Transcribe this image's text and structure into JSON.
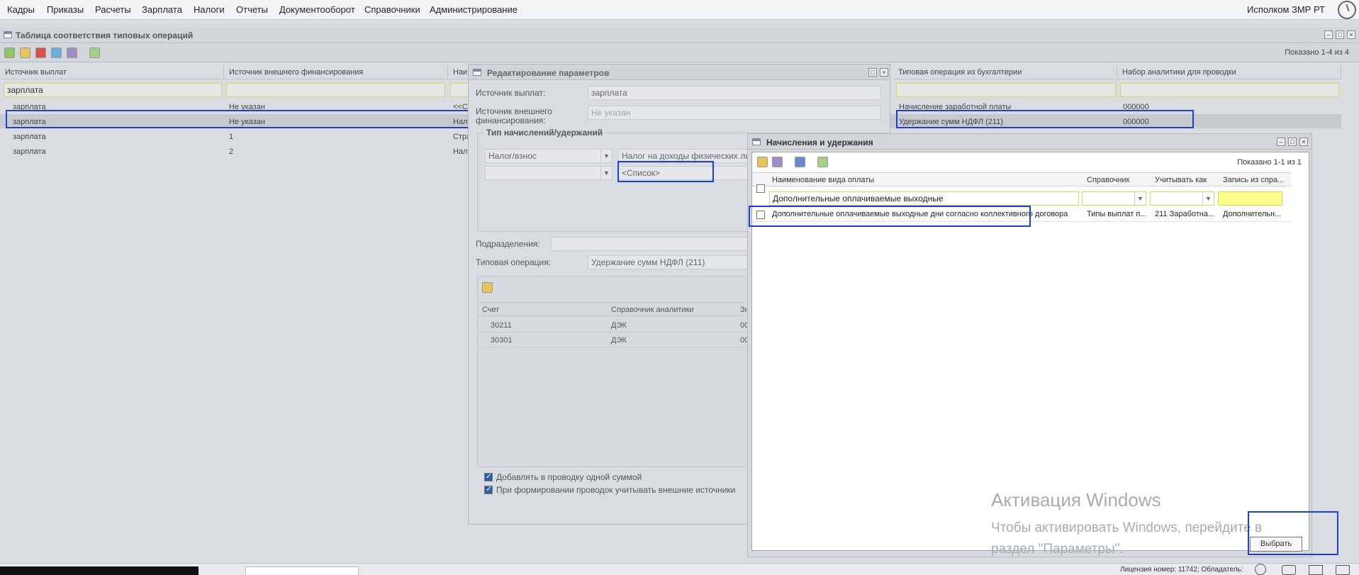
{
  "menu": {
    "items": [
      "Кадры",
      "Приказы",
      "Расчеты",
      "Зарплата",
      "Налоги",
      "Отчеты",
      "Документооборот",
      "Справочники",
      "Администрирование"
    ],
    "user": "Исполком ЗМР РТ"
  },
  "main_panel": {
    "title": "Таблица соответствия типовых операций",
    "shown": "Показано 1-4 из 4",
    "columns": [
      "Источник выплат",
      "Источник внешнего финансирования",
      "Наим",
      "Типовая операция из бухгалтерии",
      "Набор аналитики для проводки"
    ],
    "filter_source": "зарплата",
    "rows": [
      {
        "source": "зарплата",
        "ext": "Не указан",
        "name": "<<С",
        "operation": "Начисление заработной платы",
        "analytics": "000000"
      },
      {
        "source": "зарплата",
        "ext": "Не указан",
        "name": "Нало",
        "operation": "Удержание сумм НДФЛ (211)",
        "analytics": "000000"
      },
      {
        "source": "зарплата",
        "ext": "1",
        "name": "Стра",
        "operation": "",
        "analytics": ""
      },
      {
        "source": "зарплата",
        "ext": "2",
        "name": "Нало",
        "operation": "",
        "analytics": ""
      }
    ]
  },
  "edit_dialog": {
    "title": "Редактирование параметров",
    "source_label": "Источник выплат:",
    "source_value": "зарплата",
    "ext_label": "Источник внешнего финансирования:",
    "ext_value": "Не указан",
    "group_title": "Тип начислений/удержаний",
    "type_value": "Налог/взнос",
    "tax_value": "Налог на доходы физических лиц",
    "list_value": "<Список>",
    "dept_label": "Подразделения:",
    "op_label": "Типовая операция:",
    "op_value": "Удержание сумм НДФЛ (211)",
    "grid_columns": [
      "Счет",
      "Справочник аналитики",
      "Зн"
    ],
    "grid_rows": [
      {
        "account": "30211",
        "ref": "ДЭК",
        "v": "00"
      },
      {
        "account": "30301",
        "ref": "ДЭК",
        "v": "00"
      }
    ],
    "check1": "Добавлять в проводку одной суммой",
    "check2": "При формировании проводок учитывать внешние источники"
  },
  "accruals_dialog": {
    "title": "Начисления и удержания",
    "shown": "Показано 1-1 из 1",
    "columns": [
      "Наименование вида оплаты",
      "Справочник",
      "Учитывать как",
      "Запись из спра..."
    ],
    "filter_value": "Дополнительные оплачиваемые выходные",
    "row": {
      "name": "Дополнительные оплачиваемые выходные дни согласно коллективного договора",
      "ref": "Типы выплат п...",
      "as": "211 Заработна...",
      "record": "Дополнительн..."
    },
    "select_button": "Выбрать"
  },
  "watermark": {
    "line1": "Активация Windows",
    "line2": "Чтобы активировать Windows, перейдите в",
    "line3": "раздел \"Параметры\"."
  },
  "status": {
    "license": "Лицензия номер: 11742; Обладатель:"
  },
  "colors": {
    "highlight": "#1f3fd1",
    "filter_border": "#d7d46a",
    "filter_yellow": "#fdfd8a"
  }
}
